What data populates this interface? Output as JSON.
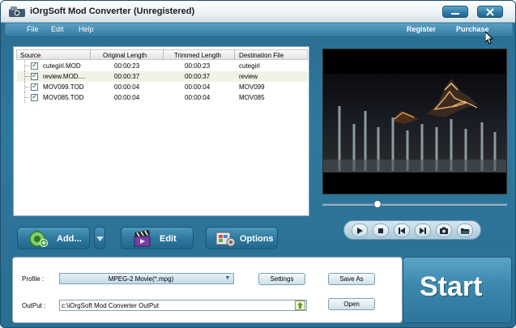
{
  "window": {
    "title": "iOrgSoft Mod Converter",
    "status": "(Unregistered)"
  },
  "menu": {
    "items": [
      "File",
      "Edit",
      "Help"
    ],
    "links": [
      "Register",
      "Purchase"
    ]
  },
  "file_list": {
    "columns": [
      "Source",
      "Original Length",
      "Trimmed Length",
      "Destination File"
    ],
    "rows": [
      {
        "source": "cutegirl.MOD",
        "original": "00:00:23",
        "trimmed": "00:00:23",
        "destination": "cutegirl",
        "checked": true
      },
      {
        "source": "review.MOD....",
        "original": "00:00:37",
        "trimmed": "00:00:37",
        "destination": "review",
        "checked": true
      },
      {
        "source": "MOV099.TOD",
        "original": "00:00:04",
        "trimmed": "00:00:04",
        "destination": "MOV099",
        "checked": true
      },
      {
        "source": "MOV085.TOD",
        "original": "00:00:04",
        "trimmed": "00:00:04",
        "destination": "MOV085",
        "checked": true
      }
    ]
  },
  "player": {
    "seek_fraction": 0.3,
    "controls": [
      "play-icon",
      "stop-icon",
      "previous-icon",
      "next-icon",
      "snapshot-icon",
      "folder-icon"
    ]
  },
  "actions": {
    "add": "Add...",
    "edit": "Edit",
    "options": "Options"
  },
  "output": {
    "profile_label": "Profile :",
    "profile_value": "MPEG-2 Movie(*.mpg)",
    "output_label": "OutPut :",
    "output_value": "c:\\iOrgSoft Mod Converter OutPut",
    "settings": "Settings",
    "save_as": "Save As",
    "open": "Open",
    "start": "Start"
  },
  "colors": {
    "accent": "#2f789d",
    "title_bar": "#eef3f6",
    "preview_bg": "#000000"
  }
}
